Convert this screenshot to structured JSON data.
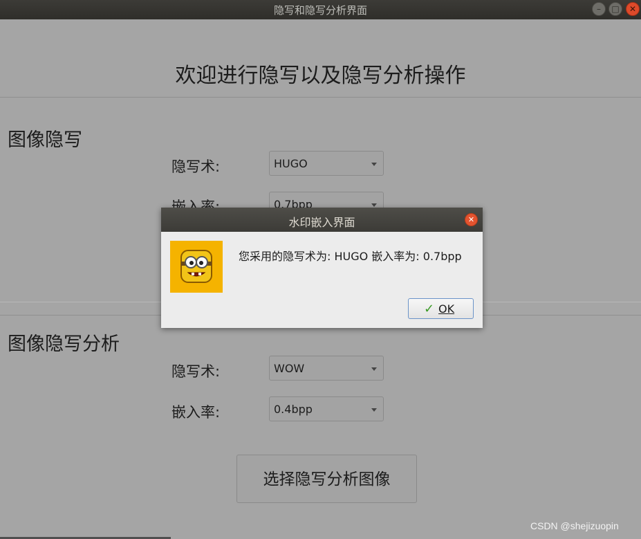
{
  "window": {
    "title": "隐写和隐写分析界面",
    "controls": {
      "minimize": "–",
      "maximize": "□",
      "close": "✕"
    }
  },
  "heading": "欢迎进行隐写以及隐写分析操作",
  "embed_section": {
    "title": "图像隐写",
    "algorithm_label": "隐写术:",
    "algorithm_value": "HUGO",
    "rate_label": "嵌入率:",
    "rate_value": "0.7bpp"
  },
  "analysis_section": {
    "title": "图像隐写分析",
    "algorithm_label": "隐写术:",
    "algorithm_value": "WOW",
    "rate_label": "嵌入率:",
    "rate_value": "0.4bpp",
    "select_button": "选择隐写分析图像"
  },
  "dialog": {
    "title": "水印嵌入界面",
    "close": "✕",
    "icon": "cartoon-face-icon",
    "message": "您采用的隐写术为: HUGO 嵌入率为: 0.7bpp",
    "ok_label": "OK",
    "ok_icon": "checkmark-icon"
  },
  "watermark": "CSDN @shejizuopin",
  "colors": {
    "background": "#a5a5a5",
    "titlebar": "#3c3b37",
    "dialog_bg": "#ececec",
    "icon_bg": "#f5b300",
    "close_red": "#dd4a2a"
  }
}
